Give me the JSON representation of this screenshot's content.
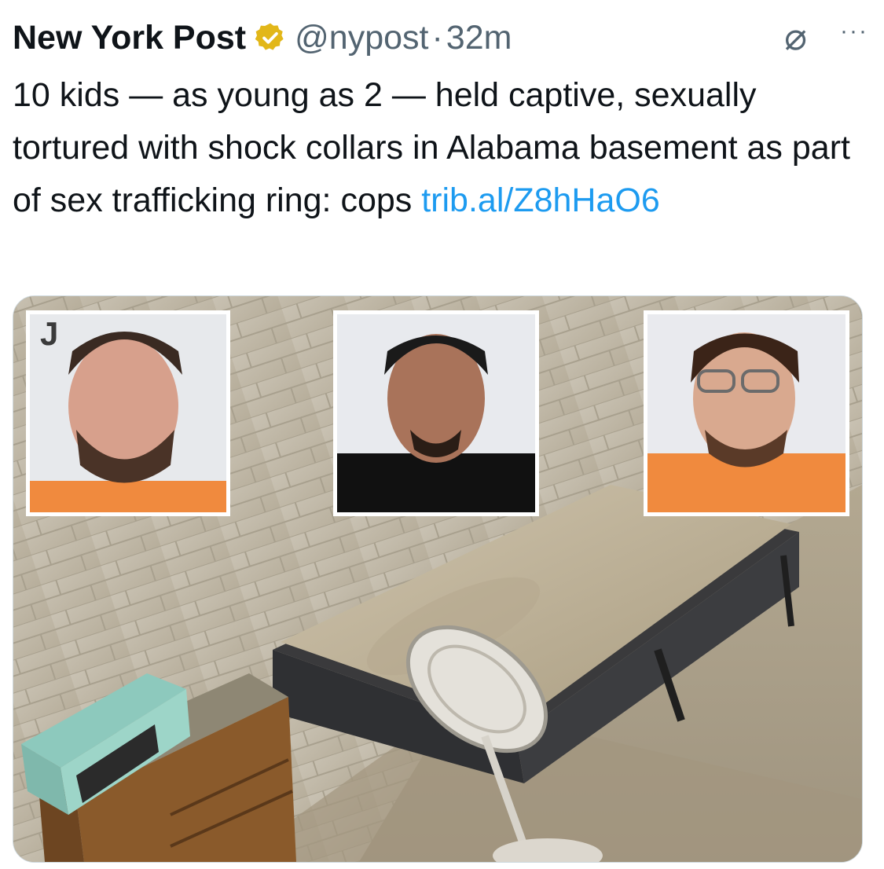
{
  "tweet": {
    "author_name": "New York Post",
    "verified_icon": "verified-badge-icon",
    "handle": "@nypost",
    "separator": "·",
    "time": "32m",
    "not_interested_icon": "⌀",
    "more_icon": "···",
    "text": "10 kids — as young as 2 — held captive, sexually tortured with shock collars in Alabama basement as part of sex trafficking ring: cops ",
    "link": "trib.al/Z8hHaO6"
  },
  "media": {
    "mugshot_label": "J",
    "colors": {
      "verified_gold": "#e2b719",
      "link_blue": "#1d9bf0",
      "secondary_text": "#536471",
      "orange_jumpsuit": "#f08a3e"
    }
  }
}
